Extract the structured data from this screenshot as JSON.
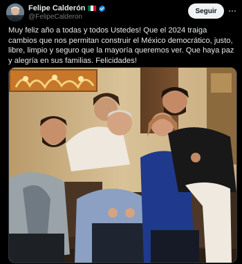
{
  "author": {
    "name": "Felipe Calderón",
    "handle": "@FelipeCalderon"
  },
  "follow_label": "Seguir",
  "tweet_text": "Muy feliz año a todas y todos Ustedes! Que el 2024 traiga cambios que nos permitan construir el México democrático, justo, libre, limpio y seguro que la mayoría queremos ver. Que haya paz y alegría en sus familias. Felicidades!",
  "colors": {
    "background": "#000000",
    "text": "#e7e9ea",
    "muted": "#71767b",
    "verified": "#1d9bf0",
    "follow_bg": "#eff3f4"
  },
  "icons": {
    "flag": "mexico-flag-icon",
    "verified": "verified-badge-icon",
    "more": "more-options-icon"
  }
}
